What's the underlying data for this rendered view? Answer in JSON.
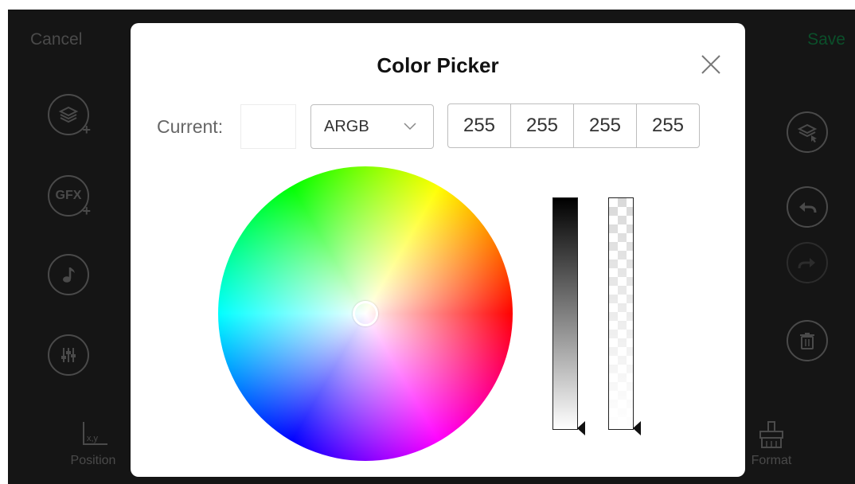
{
  "topbar": {
    "cancel_label": "Cancel",
    "save_label": "Save"
  },
  "left_toolbar": {
    "layers_add": "layers-add-icon",
    "gfx_label": "GFX",
    "music": "music-note-icon",
    "mixer": "equalizer-icon"
  },
  "right_toolbar": {
    "layer_select": "layer-select-icon",
    "undo": "undo-icon",
    "redo": "redo-icon",
    "delete": "trash-icon"
  },
  "bottom": {
    "position_label": "Position",
    "position_icon_text": "x,y",
    "format_label": "Format"
  },
  "dialog": {
    "title": "Color Picker",
    "current_label": "Current:",
    "mode": "ARGB",
    "channels": [
      "255",
      "255",
      "255",
      "255"
    ],
    "current_color": "#ffffff"
  },
  "colors": {
    "app_background": "#151515",
    "save_accent": "#0b4f2a",
    "dim_text": "#4a4a4a"
  }
}
